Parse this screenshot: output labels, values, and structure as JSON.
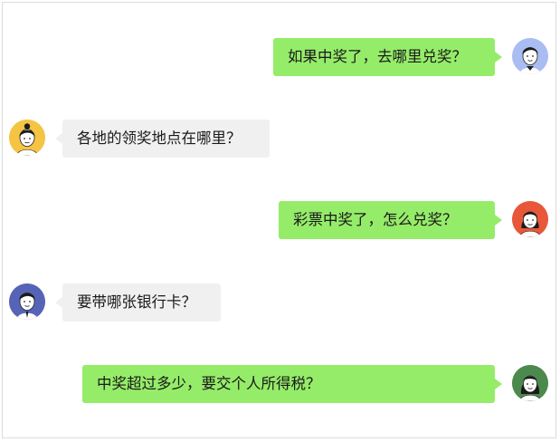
{
  "messages": [
    {
      "side": "right",
      "text": "如果中奖了，去哪里兑奖？",
      "avatar": "male-avatar-blue-icon"
    },
    {
      "side": "left",
      "text": "各地的领奖地点在哪里？",
      "avatar": "female-avatar-yellow-icon"
    },
    {
      "side": "right",
      "text": "彩票中奖了，怎么兑奖？",
      "avatar": "female-avatar-red-icon"
    },
    {
      "side": "left",
      "text": "要带哪张银行卡？",
      "avatar": "male-avatar-indigo-icon"
    },
    {
      "side": "right",
      "text": "中奖超过多少，要交个人所得税？",
      "avatar": "female-avatar-green-icon"
    }
  ],
  "colors": {
    "outgoing_bubble": "#95ec69",
    "incoming_bubble": "#f0f0f0"
  }
}
